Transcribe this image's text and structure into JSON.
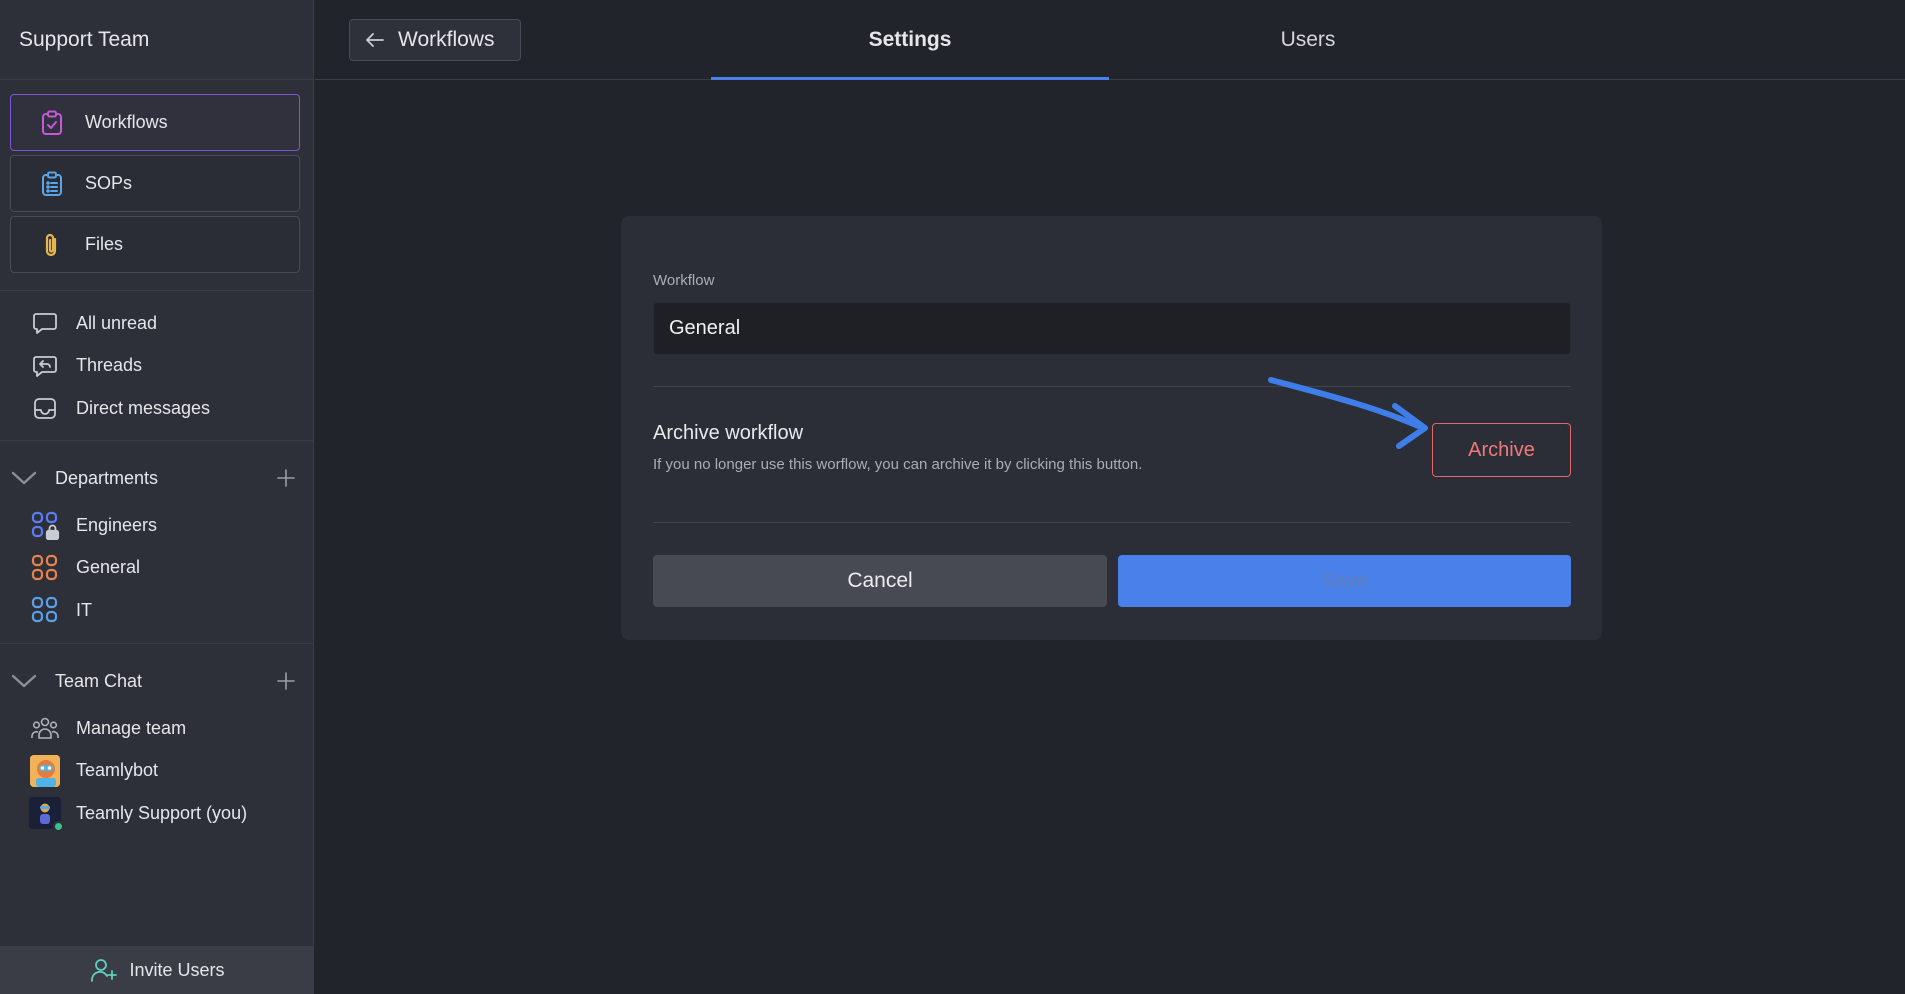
{
  "sidebar": {
    "team_name": "Support Team",
    "main_nav": [
      {
        "label": "Workflows",
        "icon": "clipboard-check-icon",
        "active": true
      },
      {
        "label": "SOPs",
        "icon": "clipboard-list-icon",
        "active": false
      },
      {
        "label": "Files",
        "icon": "paperclip-icon",
        "active": false
      }
    ],
    "inbox_items": [
      {
        "label": "All unread",
        "icon": "chat-bubble-icon"
      },
      {
        "label": "Threads",
        "icon": "thread-reply-icon"
      },
      {
        "label": "Direct messages",
        "icon": "inbox-icon"
      }
    ],
    "departments": {
      "title": "Departments",
      "items": [
        {
          "label": "Engineers",
          "icon": "grid-lock-icon",
          "color": "#5b7cf5"
        },
        {
          "label": "General",
          "icon": "grid-icon",
          "color": "#e8834f"
        },
        {
          "label": "IT",
          "icon": "grid-icon",
          "color": "#5aa0e8"
        }
      ]
    },
    "team_chat": {
      "title": "Team Chat",
      "items": [
        {
          "label": "Manage team",
          "icon": "people-group-icon"
        },
        {
          "label": "Teamlybot",
          "icon": "bot-avatar"
        },
        {
          "label": "Teamly Support (you)",
          "icon": "user-avatar"
        }
      ]
    },
    "invite_label": "Invite Users"
  },
  "topbar": {
    "back_label": "Workflows",
    "tabs": [
      {
        "label": "Settings",
        "active": true
      },
      {
        "label": "Users",
        "active": false
      }
    ]
  },
  "card": {
    "field_label": "Workflow",
    "field_value": "General",
    "archive_title": "Archive workflow",
    "archive_description": "If you no longer use this worflow, you can archive it by clicking this button.",
    "archive_button": "Archive",
    "cancel_button": "Cancel",
    "save_button": "Save"
  },
  "colors": {
    "accent": "#4a80ea",
    "danger": "#e06868",
    "active_border": "#7b55d6"
  }
}
